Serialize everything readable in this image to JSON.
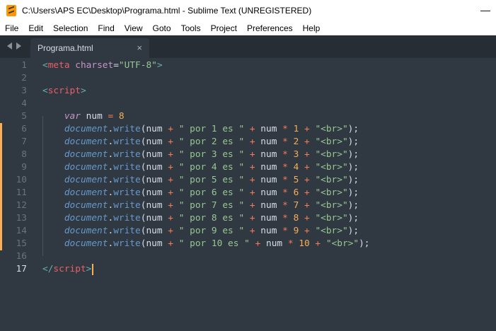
{
  "window": {
    "title": "C:\\Users\\APS EC\\Desktop\\Programa.html - Sublime Text (UNREGISTERED)",
    "minimize_symbol": "—"
  },
  "menu": [
    "File",
    "Edit",
    "Selection",
    "Find",
    "View",
    "Goto",
    "Tools",
    "Project",
    "Preferences",
    "Help"
  ],
  "tabs": [
    {
      "label": "Programa.html",
      "close": "×",
      "active": true
    }
  ],
  "editor": {
    "active_line": 17,
    "lines": [
      {
        "n": "1",
        "modified": false,
        "tokens": [
          [
            "t-tag-br",
            "<"
          ],
          [
            "t-tag",
            "meta"
          ],
          [
            "t-punc",
            " "
          ],
          [
            "t-attr",
            "charset"
          ],
          [
            "t-punc",
            "="
          ],
          [
            "t-str",
            "\"UTF-8\""
          ],
          [
            "t-tag-br",
            ">"
          ]
        ]
      },
      {
        "n": "2",
        "modified": false,
        "tokens": []
      },
      {
        "n": "3",
        "modified": false,
        "tokens": [
          [
            "t-tag-br",
            "<"
          ],
          [
            "t-tag",
            "script"
          ],
          [
            "t-tag-br",
            ">"
          ]
        ]
      },
      {
        "n": "4",
        "modified": false,
        "tokens": []
      },
      {
        "n": "5",
        "modified": false,
        "tokens": [
          [
            "t-punc",
            "    "
          ],
          [
            "t-kw",
            "var"
          ],
          [
            "t-var",
            " num "
          ],
          [
            "t-op",
            "="
          ],
          [
            "t-var",
            " "
          ],
          [
            "t-num",
            "8"
          ]
        ]
      },
      {
        "n": "6",
        "modified": true,
        "tokens": [
          [
            "t-punc",
            "    "
          ],
          [
            "t-obj",
            "document"
          ],
          [
            "t-dot",
            "."
          ],
          [
            "t-fn",
            "write"
          ],
          [
            "t-punc",
            "("
          ],
          [
            "t-var",
            "num "
          ],
          [
            "t-op",
            "+"
          ],
          [
            "t-punc",
            " "
          ],
          [
            "t-str",
            "\" por 1 es \""
          ],
          [
            "t-punc",
            " "
          ],
          [
            "t-op",
            "+"
          ],
          [
            "t-var",
            " num "
          ],
          [
            "t-op",
            "*"
          ],
          [
            "t-punc",
            " "
          ],
          [
            "t-num",
            "1"
          ],
          [
            "t-punc",
            " "
          ],
          [
            "t-op",
            "+"
          ],
          [
            "t-punc",
            " "
          ],
          [
            "t-str",
            "\"<br>\""
          ],
          [
            "t-punc",
            ");"
          ]
        ]
      },
      {
        "n": "7",
        "modified": true,
        "tokens": [
          [
            "t-punc",
            "    "
          ],
          [
            "t-obj",
            "document"
          ],
          [
            "t-dot",
            "."
          ],
          [
            "t-fn",
            "write"
          ],
          [
            "t-punc",
            "("
          ],
          [
            "t-var",
            "num "
          ],
          [
            "t-op",
            "+"
          ],
          [
            "t-punc",
            " "
          ],
          [
            "t-str",
            "\" por 2 es \""
          ],
          [
            "t-punc",
            " "
          ],
          [
            "t-op",
            "+"
          ],
          [
            "t-var",
            " num "
          ],
          [
            "t-op",
            "*"
          ],
          [
            "t-punc",
            " "
          ],
          [
            "t-num",
            "2"
          ],
          [
            "t-punc",
            " "
          ],
          [
            "t-op",
            "+"
          ],
          [
            "t-punc",
            " "
          ],
          [
            "t-str",
            "\"<br>\""
          ],
          [
            "t-punc",
            ");"
          ]
        ]
      },
      {
        "n": "8",
        "modified": true,
        "tokens": [
          [
            "t-punc",
            "    "
          ],
          [
            "t-obj",
            "document"
          ],
          [
            "t-dot",
            "."
          ],
          [
            "t-fn",
            "write"
          ],
          [
            "t-punc",
            "("
          ],
          [
            "t-var",
            "num "
          ],
          [
            "t-op",
            "+"
          ],
          [
            "t-punc",
            " "
          ],
          [
            "t-str",
            "\" por 3 es \""
          ],
          [
            "t-punc",
            " "
          ],
          [
            "t-op",
            "+"
          ],
          [
            "t-var",
            " num "
          ],
          [
            "t-op",
            "*"
          ],
          [
            "t-punc",
            " "
          ],
          [
            "t-num",
            "3"
          ],
          [
            "t-punc",
            " "
          ],
          [
            "t-op",
            "+"
          ],
          [
            "t-punc",
            " "
          ],
          [
            "t-str",
            "\"<br>\""
          ],
          [
            "t-punc",
            ");"
          ]
        ]
      },
      {
        "n": "9",
        "modified": true,
        "tokens": [
          [
            "t-punc",
            "    "
          ],
          [
            "t-obj",
            "document"
          ],
          [
            "t-dot",
            "."
          ],
          [
            "t-fn",
            "write"
          ],
          [
            "t-punc",
            "("
          ],
          [
            "t-var",
            "num "
          ],
          [
            "t-op",
            "+"
          ],
          [
            "t-punc",
            " "
          ],
          [
            "t-str",
            "\" por 4 es \""
          ],
          [
            "t-punc",
            " "
          ],
          [
            "t-op",
            "+"
          ],
          [
            "t-var",
            " num "
          ],
          [
            "t-op",
            "*"
          ],
          [
            "t-punc",
            " "
          ],
          [
            "t-num",
            "4"
          ],
          [
            "t-punc",
            " "
          ],
          [
            "t-op",
            "+"
          ],
          [
            "t-punc",
            " "
          ],
          [
            "t-str",
            "\"<br>\""
          ],
          [
            "t-punc",
            ");"
          ]
        ]
      },
      {
        "n": "10",
        "modified": true,
        "tokens": [
          [
            "t-punc",
            "    "
          ],
          [
            "t-obj",
            "document"
          ],
          [
            "t-dot",
            "."
          ],
          [
            "t-fn",
            "write"
          ],
          [
            "t-punc",
            "("
          ],
          [
            "t-var",
            "num "
          ],
          [
            "t-op",
            "+"
          ],
          [
            "t-punc",
            " "
          ],
          [
            "t-str",
            "\" por 5 es \""
          ],
          [
            "t-punc",
            " "
          ],
          [
            "t-op",
            "+"
          ],
          [
            "t-var",
            " num "
          ],
          [
            "t-op",
            "*"
          ],
          [
            "t-punc",
            " "
          ],
          [
            "t-num",
            "5"
          ],
          [
            "t-punc",
            " "
          ],
          [
            "t-op",
            "+"
          ],
          [
            "t-punc",
            " "
          ],
          [
            "t-str",
            "\"<br>\""
          ],
          [
            "t-punc",
            ");"
          ]
        ]
      },
      {
        "n": "11",
        "modified": true,
        "tokens": [
          [
            "t-punc",
            "    "
          ],
          [
            "t-obj",
            "document"
          ],
          [
            "t-dot",
            "."
          ],
          [
            "t-fn",
            "write"
          ],
          [
            "t-punc",
            "("
          ],
          [
            "t-var",
            "num "
          ],
          [
            "t-op",
            "+"
          ],
          [
            "t-punc",
            " "
          ],
          [
            "t-str",
            "\" por 6 es \""
          ],
          [
            "t-punc",
            " "
          ],
          [
            "t-op",
            "+"
          ],
          [
            "t-var",
            " num "
          ],
          [
            "t-op",
            "*"
          ],
          [
            "t-punc",
            " "
          ],
          [
            "t-num",
            "6"
          ],
          [
            "t-punc",
            " "
          ],
          [
            "t-op",
            "+"
          ],
          [
            "t-punc",
            " "
          ],
          [
            "t-str",
            "\"<br>\""
          ],
          [
            "t-punc",
            ");"
          ]
        ]
      },
      {
        "n": "12",
        "modified": true,
        "tokens": [
          [
            "t-punc",
            "    "
          ],
          [
            "t-obj",
            "document"
          ],
          [
            "t-dot",
            "."
          ],
          [
            "t-fn",
            "write"
          ],
          [
            "t-punc",
            "("
          ],
          [
            "t-var",
            "num "
          ],
          [
            "t-op",
            "+"
          ],
          [
            "t-punc",
            " "
          ],
          [
            "t-str",
            "\" por 7 es \""
          ],
          [
            "t-punc",
            " "
          ],
          [
            "t-op",
            "+"
          ],
          [
            "t-var",
            " num "
          ],
          [
            "t-op",
            "*"
          ],
          [
            "t-punc",
            " "
          ],
          [
            "t-num",
            "7"
          ],
          [
            "t-punc",
            " "
          ],
          [
            "t-op",
            "+"
          ],
          [
            "t-punc",
            " "
          ],
          [
            "t-str",
            "\"<br>\""
          ],
          [
            "t-punc",
            ");"
          ]
        ]
      },
      {
        "n": "13",
        "modified": true,
        "tokens": [
          [
            "t-punc",
            "    "
          ],
          [
            "t-obj",
            "document"
          ],
          [
            "t-dot",
            "."
          ],
          [
            "t-fn",
            "write"
          ],
          [
            "t-punc",
            "("
          ],
          [
            "t-var",
            "num "
          ],
          [
            "t-op",
            "+"
          ],
          [
            "t-punc",
            " "
          ],
          [
            "t-str",
            "\" por 8 es \""
          ],
          [
            "t-punc",
            " "
          ],
          [
            "t-op",
            "+"
          ],
          [
            "t-var",
            " num "
          ],
          [
            "t-op",
            "*"
          ],
          [
            "t-punc",
            " "
          ],
          [
            "t-num",
            "8"
          ],
          [
            "t-punc",
            " "
          ],
          [
            "t-op",
            "+"
          ],
          [
            "t-punc",
            " "
          ],
          [
            "t-str",
            "\"<br>\""
          ],
          [
            "t-punc",
            ");"
          ]
        ]
      },
      {
        "n": "14",
        "modified": true,
        "tokens": [
          [
            "t-punc",
            "    "
          ],
          [
            "t-obj",
            "document"
          ],
          [
            "t-dot",
            "."
          ],
          [
            "t-fn",
            "write"
          ],
          [
            "t-punc",
            "("
          ],
          [
            "t-var",
            "num "
          ],
          [
            "t-op",
            "+"
          ],
          [
            "t-punc",
            " "
          ],
          [
            "t-str",
            "\" por 9 es \""
          ],
          [
            "t-punc",
            " "
          ],
          [
            "t-op",
            "+"
          ],
          [
            "t-var",
            " num "
          ],
          [
            "t-op",
            "*"
          ],
          [
            "t-punc",
            " "
          ],
          [
            "t-num",
            "9"
          ],
          [
            "t-punc",
            " "
          ],
          [
            "t-op",
            "+"
          ],
          [
            "t-punc",
            " "
          ],
          [
            "t-str",
            "\"<br>\""
          ],
          [
            "t-punc",
            ");"
          ]
        ]
      },
      {
        "n": "15",
        "modified": true,
        "tokens": [
          [
            "t-punc",
            "    "
          ],
          [
            "t-obj",
            "document"
          ],
          [
            "t-dot",
            "."
          ],
          [
            "t-fn",
            "write"
          ],
          [
            "t-punc",
            "("
          ],
          [
            "t-var",
            "num "
          ],
          [
            "t-op",
            "+"
          ],
          [
            "t-punc",
            " "
          ],
          [
            "t-str",
            "\" por 10 es \""
          ],
          [
            "t-punc",
            " "
          ],
          [
            "t-op",
            "+"
          ],
          [
            "t-var",
            " num "
          ],
          [
            "t-op",
            "*"
          ],
          [
            "t-punc",
            " "
          ],
          [
            "t-num",
            "10"
          ],
          [
            "t-punc",
            " "
          ],
          [
            "t-op",
            "+"
          ],
          [
            "t-punc",
            " "
          ],
          [
            "t-str",
            "\"<br>\""
          ],
          [
            "t-punc",
            ");"
          ]
        ]
      },
      {
        "n": "16",
        "modified": false,
        "tokens": []
      },
      {
        "n": "17",
        "modified": false,
        "caret": true,
        "tokens": [
          [
            "t-tag-br",
            "</"
          ],
          [
            "t-tag",
            "script"
          ],
          [
            "t-tag-br",
            ">"
          ]
        ]
      }
    ]
  },
  "colors": {
    "background": "#303841",
    "tabbar": "#262d35",
    "modified_marker": "#f9ae58",
    "caret": "#f9ae58"
  }
}
